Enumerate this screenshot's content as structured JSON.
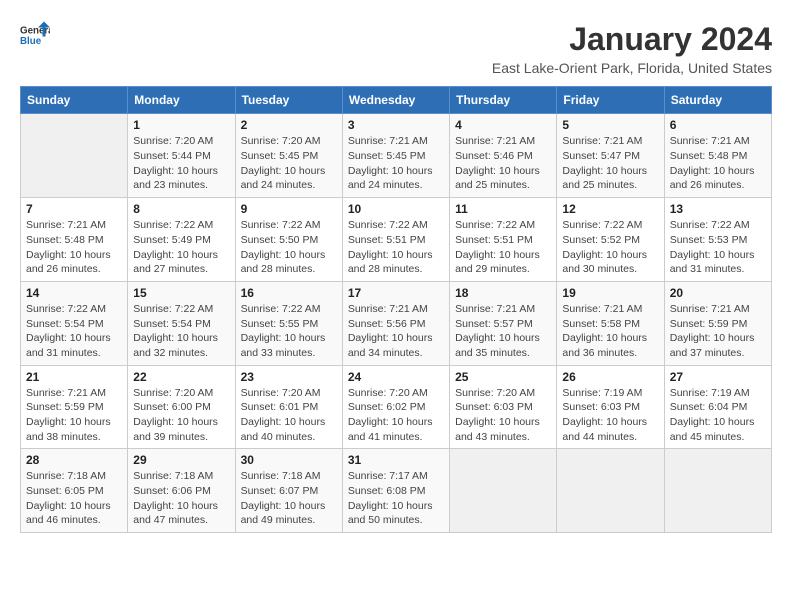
{
  "logo": {
    "general": "General",
    "blue": "Blue"
  },
  "header": {
    "title": "January 2024",
    "subtitle": "East Lake-Orient Park, Florida, United States"
  },
  "days_of_week": [
    "Sunday",
    "Monday",
    "Tuesday",
    "Wednesday",
    "Thursday",
    "Friday",
    "Saturday"
  ],
  "weeks": [
    [
      {
        "num": "",
        "info": ""
      },
      {
        "num": "1",
        "info": "Sunrise: 7:20 AM\nSunset: 5:44 PM\nDaylight: 10 hours\nand 23 minutes."
      },
      {
        "num": "2",
        "info": "Sunrise: 7:20 AM\nSunset: 5:45 PM\nDaylight: 10 hours\nand 24 minutes."
      },
      {
        "num": "3",
        "info": "Sunrise: 7:21 AM\nSunset: 5:45 PM\nDaylight: 10 hours\nand 24 minutes."
      },
      {
        "num": "4",
        "info": "Sunrise: 7:21 AM\nSunset: 5:46 PM\nDaylight: 10 hours\nand 25 minutes."
      },
      {
        "num": "5",
        "info": "Sunrise: 7:21 AM\nSunset: 5:47 PM\nDaylight: 10 hours\nand 25 minutes."
      },
      {
        "num": "6",
        "info": "Sunrise: 7:21 AM\nSunset: 5:48 PM\nDaylight: 10 hours\nand 26 minutes."
      }
    ],
    [
      {
        "num": "7",
        "info": "Sunrise: 7:21 AM\nSunset: 5:48 PM\nDaylight: 10 hours\nand 26 minutes."
      },
      {
        "num": "8",
        "info": "Sunrise: 7:22 AM\nSunset: 5:49 PM\nDaylight: 10 hours\nand 27 minutes."
      },
      {
        "num": "9",
        "info": "Sunrise: 7:22 AM\nSunset: 5:50 PM\nDaylight: 10 hours\nand 28 minutes."
      },
      {
        "num": "10",
        "info": "Sunrise: 7:22 AM\nSunset: 5:51 PM\nDaylight: 10 hours\nand 28 minutes."
      },
      {
        "num": "11",
        "info": "Sunrise: 7:22 AM\nSunset: 5:51 PM\nDaylight: 10 hours\nand 29 minutes."
      },
      {
        "num": "12",
        "info": "Sunrise: 7:22 AM\nSunset: 5:52 PM\nDaylight: 10 hours\nand 30 minutes."
      },
      {
        "num": "13",
        "info": "Sunrise: 7:22 AM\nSunset: 5:53 PM\nDaylight: 10 hours\nand 31 minutes."
      }
    ],
    [
      {
        "num": "14",
        "info": "Sunrise: 7:22 AM\nSunset: 5:54 PM\nDaylight: 10 hours\nand 31 minutes."
      },
      {
        "num": "15",
        "info": "Sunrise: 7:22 AM\nSunset: 5:54 PM\nDaylight: 10 hours\nand 32 minutes."
      },
      {
        "num": "16",
        "info": "Sunrise: 7:22 AM\nSunset: 5:55 PM\nDaylight: 10 hours\nand 33 minutes."
      },
      {
        "num": "17",
        "info": "Sunrise: 7:21 AM\nSunset: 5:56 PM\nDaylight: 10 hours\nand 34 minutes."
      },
      {
        "num": "18",
        "info": "Sunrise: 7:21 AM\nSunset: 5:57 PM\nDaylight: 10 hours\nand 35 minutes."
      },
      {
        "num": "19",
        "info": "Sunrise: 7:21 AM\nSunset: 5:58 PM\nDaylight: 10 hours\nand 36 minutes."
      },
      {
        "num": "20",
        "info": "Sunrise: 7:21 AM\nSunset: 5:59 PM\nDaylight: 10 hours\nand 37 minutes."
      }
    ],
    [
      {
        "num": "21",
        "info": "Sunrise: 7:21 AM\nSunset: 5:59 PM\nDaylight: 10 hours\nand 38 minutes."
      },
      {
        "num": "22",
        "info": "Sunrise: 7:20 AM\nSunset: 6:00 PM\nDaylight: 10 hours\nand 39 minutes."
      },
      {
        "num": "23",
        "info": "Sunrise: 7:20 AM\nSunset: 6:01 PM\nDaylight: 10 hours\nand 40 minutes."
      },
      {
        "num": "24",
        "info": "Sunrise: 7:20 AM\nSunset: 6:02 PM\nDaylight: 10 hours\nand 41 minutes."
      },
      {
        "num": "25",
        "info": "Sunrise: 7:20 AM\nSunset: 6:03 PM\nDaylight: 10 hours\nand 43 minutes."
      },
      {
        "num": "26",
        "info": "Sunrise: 7:19 AM\nSunset: 6:03 PM\nDaylight: 10 hours\nand 44 minutes."
      },
      {
        "num": "27",
        "info": "Sunrise: 7:19 AM\nSunset: 6:04 PM\nDaylight: 10 hours\nand 45 minutes."
      }
    ],
    [
      {
        "num": "28",
        "info": "Sunrise: 7:18 AM\nSunset: 6:05 PM\nDaylight: 10 hours\nand 46 minutes."
      },
      {
        "num": "29",
        "info": "Sunrise: 7:18 AM\nSunset: 6:06 PM\nDaylight: 10 hours\nand 47 minutes."
      },
      {
        "num": "30",
        "info": "Sunrise: 7:18 AM\nSunset: 6:07 PM\nDaylight: 10 hours\nand 49 minutes."
      },
      {
        "num": "31",
        "info": "Sunrise: 7:17 AM\nSunset: 6:08 PM\nDaylight: 10 hours\nand 50 minutes."
      },
      {
        "num": "",
        "info": ""
      },
      {
        "num": "",
        "info": ""
      },
      {
        "num": "",
        "info": ""
      }
    ]
  ]
}
